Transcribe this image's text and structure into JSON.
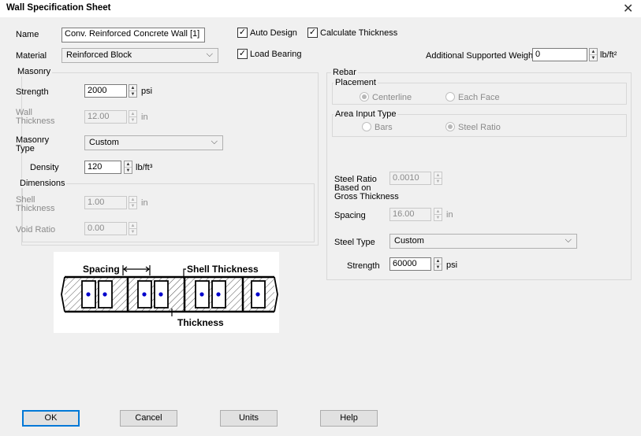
{
  "window": {
    "title": "Wall Specification Sheet",
    "close": "✕"
  },
  "general": {
    "name_label": "Name",
    "name_value": "Conv. Reinforced Concrete Wall [1]",
    "material_label": "Material",
    "material_value": "Reinforced Block",
    "auto_design_label": "Auto Design",
    "auto_design_checked": true,
    "calc_thickness_label": "Calculate Thickness",
    "calc_thickness_checked": true,
    "load_bearing_label": "Load Bearing",
    "load_bearing_checked": true,
    "supported_weight_label": "Additional Supported Weight",
    "supported_weight_value": "0",
    "supported_weight_unit": "lb/ft²"
  },
  "masonry": {
    "group_label": "Masonry",
    "strength_label": "Strength",
    "strength_value": "2000",
    "strength_unit": "psi",
    "wall_thickness_label_1": "Wall",
    "wall_thickness_label_2": "Thickness",
    "wall_thickness_value": "12.00",
    "wall_thickness_unit": "in",
    "type_label_1": "Masonry",
    "type_label_2": "Type",
    "type_value": "Custom",
    "density_label": "Density",
    "density_value": "120",
    "density_unit": "lb/ft³",
    "dimensions": {
      "group_label": "Dimensions",
      "shell_label_1": "Shell",
      "shell_label_2": "Thickness",
      "shell_value": "1.00",
      "shell_unit": "in",
      "void_label": "Void Ratio",
      "void_value": "0.00"
    }
  },
  "rebar": {
    "group_label": "Rebar",
    "placement": {
      "group_label": "Placement",
      "centerline_label": "Centerline",
      "each_face_label": "Each Face",
      "selected": "Centerline"
    },
    "area_input": {
      "group_label": "Area Input Type",
      "bars_label": "Bars",
      "steel_ratio_label": "Steel Ratio",
      "selected": "Steel Ratio"
    },
    "steel_ratio_label_1": "Steel Ratio",
    "steel_ratio_label_2": "Based on",
    "steel_ratio_label_3": "Gross Thickness",
    "steel_ratio_value": "0.0010",
    "spacing_label": "Spacing",
    "spacing_value": "16.00",
    "spacing_unit": "in",
    "steel_type_label": "Steel Type",
    "steel_type_value": "Custom",
    "strength_label": "Strength",
    "strength_value": "60000",
    "strength_unit": "psi"
  },
  "diagram": {
    "spacing_label": "Spacing",
    "shell_thickness_label": "Shell Thickness",
    "thickness_label": "Thickness"
  },
  "buttons": {
    "ok": "OK",
    "cancel": "Cancel",
    "units": "Units",
    "help": "Help"
  },
  "colors": {
    "accent": "#0078d7",
    "rebar_dot": "#0000cc"
  }
}
